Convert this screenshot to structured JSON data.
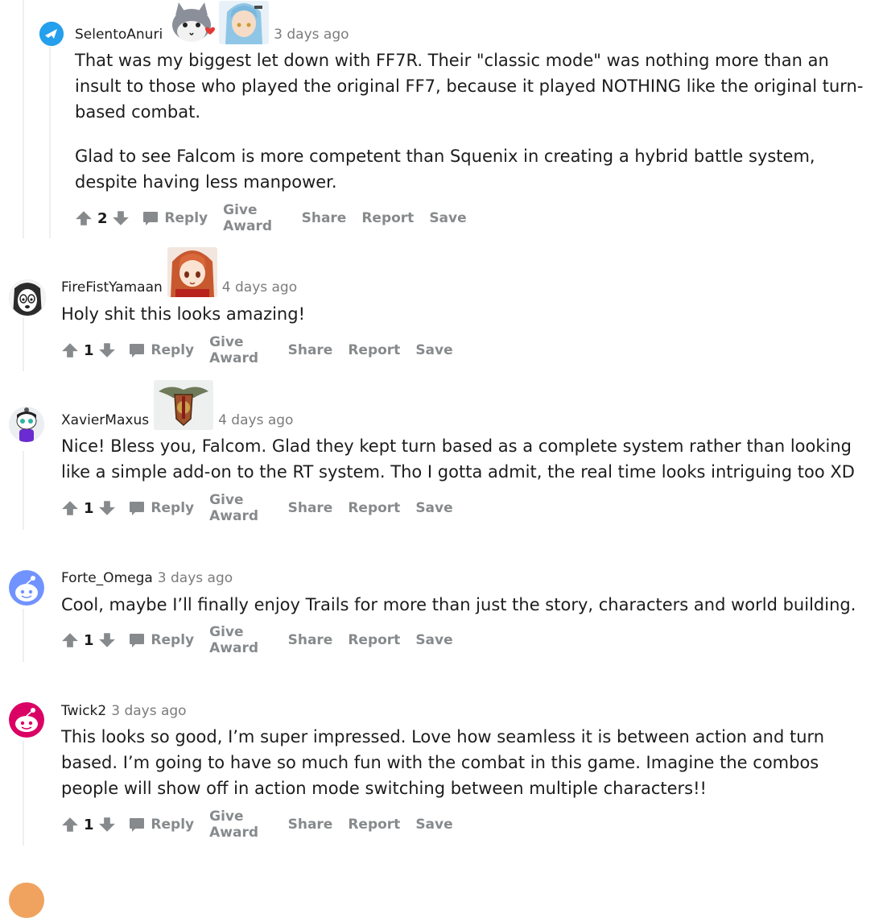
{
  "actions": {
    "reply": "Reply",
    "give_award": "Give Award",
    "share": "Share",
    "report": "Report",
    "save": "Save"
  },
  "comments": [
    {
      "username": "SelentoAnuri",
      "time": "3 days ago",
      "flairs": [
        "cat-mascot-flair",
        "blue-haired-character-flair"
      ],
      "paragraphs": [
        "That was my biggest let down with FF7R. Their \"classic mode\" was nothing more than an insult to those who played the original FF7, because it played NOTHING like the original turn-based combat.",
        "Glad to see Falcom is more competent than Squenix in creating a hybrid battle system, despite having less manpower."
      ],
      "score": "2",
      "avatar_icon": "blue-airplane-avatar-icon"
    },
    {
      "username": "FireFistYamaan",
      "time": "4 days ago",
      "flairs": [
        "red-haired-character-flair"
      ],
      "paragraphs": [
        "Holy shit this looks amazing!"
      ],
      "score": "1",
      "avatar_icon": "manga-face-avatar-icon"
    },
    {
      "username": "XavierMaxus",
      "time": "4 days ago",
      "flairs": [
        "winged-emblem-flair"
      ],
      "paragraphs": [
        "Nice! Bless you, Falcom. Glad they kept turn based as a complete system rather than looking like a simple add-on to the RT system. Tho I gotta admit, the real time looks intriguing too XD"
      ],
      "score": "1",
      "avatar_icon": "snoo-character-avatar-icon"
    },
    {
      "username": "Forte_Omega",
      "time": "3 days ago",
      "flairs": [],
      "paragraphs": [
        "Cool, maybe I’ll finally enjoy Trails for more than just the story, characters and world building."
      ],
      "score": "1",
      "avatar_icon": "blue-snoo-avatar-icon"
    },
    {
      "username": "Twick2",
      "time": "3 days ago",
      "flairs": [],
      "paragraphs": [
        "This looks so good, I’m super impressed. Love how seamless it is between action and turn based. I’m going to have so much fun with the combat in this game. Imagine the combos people will show off in action mode switching between multiple characters!!"
      ],
      "score": "1",
      "avatar_icon": "pink-snoo-avatar-icon"
    }
  ]
}
